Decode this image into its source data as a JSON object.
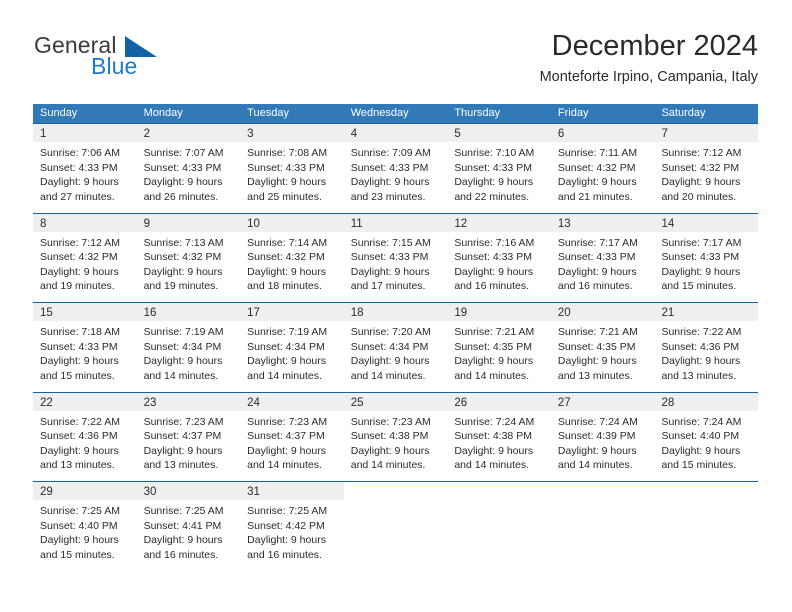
{
  "brand": {
    "name_top": "General",
    "name_bottom": "Blue",
    "triangle_icon": "triangle-icon",
    "accent_color": "#1263a5",
    "blue_text_color": "#1f7ac0"
  },
  "header": {
    "month_title": "December 2024",
    "location": "Monteforte Irpino, Campania, Italy"
  },
  "calendar": {
    "header_bg": "#3279b7",
    "row_divider_color": "#1263a5",
    "daynum_bg": "#efefef",
    "weekdays": [
      "Sunday",
      "Monday",
      "Tuesday",
      "Wednesday",
      "Thursday",
      "Friday",
      "Saturday"
    ],
    "weeks": [
      [
        {
          "day": "1",
          "sunrise": "Sunrise: 7:06 AM",
          "sunset": "Sunset: 4:33 PM",
          "daylight1": "Daylight: 9 hours",
          "daylight2": "and 27 minutes."
        },
        {
          "day": "2",
          "sunrise": "Sunrise: 7:07 AM",
          "sunset": "Sunset: 4:33 PM",
          "daylight1": "Daylight: 9 hours",
          "daylight2": "and 26 minutes."
        },
        {
          "day": "3",
          "sunrise": "Sunrise: 7:08 AM",
          "sunset": "Sunset: 4:33 PM",
          "daylight1": "Daylight: 9 hours",
          "daylight2": "and 25 minutes."
        },
        {
          "day": "4",
          "sunrise": "Sunrise: 7:09 AM",
          "sunset": "Sunset: 4:33 PM",
          "daylight1": "Daylight: 9 hours",
          "daylight2": "and 23 minutes."
        },
        {
          "day": "5",
          "sunrise": "Sunrise: 7:10 AM",
          "sunset": "Sunset: 4:33 PM",
          "daylight1": "Daylight: 9 hours",
          "daylight2": "and 22 minutes."
        },
        {
          "day": "6",
          "sunrise": "Sunrise: 7:11 AM",
          "sunset": "Sunset: 4:32 PM",
          "daylight1": "Daylight: 9 hours",
          "daylight2": "and 21 minutes."
        },
        {
          "day": "7",
          "sunrise": "Sunrise: 7:12 AM",
          "sunset": "Sunset: 4:32 PM",
          "daylight1": "Daylight: 9 hours",
          "daylight2": "and 20 minutes."
        }
      ],
      [
        {
          "day": "8",
          "sunrise": "Sunrise: 7:12 AM",
          "sunset": "Sunset: 4:32 PM",
          "daylight1": "Daylight: 9 hours",
          "daylight2": "and 19 minutes."
        },
        {
          "day": "9",
          "sunrise": "Sunrise: 7:13 AM",
          "sunset": "Sunset: 4:32 PM",
          "daylight1": "Daylight: 9 hours",
          "daylight2": "and 19 minutes."
        },
        {
          "day": "10",
          "sunrise": "Sunrise: 7:14 AM",
          "sunset": "Sunset: 4:32 PM",
          "daylight1": "Daylight: 9 hours",
          "daylight2": "and 18 minutes."
        },
        {
          "day": "11",
          "sunrise": "Sunrise: 7:15 AM",
          "sunset": "Sunset: 4:33 PM",
          "daylight1": "Daylight: 9 hours",
          "daylight2": "and 17 minutes."
        },
        {
          "day": "12",
          "sunrise": "Sunrise: 7:16 AM",
          "sunset": "Sunset: 4:33 PM",
          "daylight1": "Daylight: 9 hours",
          "daylight2": "and 16 minutes."
        },
        {
          "day": "13",
          "sunrise": "Sunrise: 7:17 AM",
          "sunset": "Sunset: 4:33 PM",
          "daylight1": "Daylight: 9 hours",
          "daylight2": "and 16 minutes."
        },
        {
          "day": "14",
          "sunrise": "Sunrise: 7:17 AM",
          "sunset": "Sunset: 4:33 PM",
          "daylight1": "Daylight: 9 hours",
          "daylight2": "and 15 minutes."
        }
      ],
      [
        {
          "day": "15",
          "sunrise": "Sunrise: 7:18 AM",
          "sunset": "Sunset: 4:33 PM",
          "daylight1": "Daylight: 9 hours",
          "daylight2": "and 15 minutes."
        },
        {
          "day": "16",
          "sunrise": "Sunrise: 7:19 AM",
          "sunset": "Sunset: 4:34 PM",
          "daylight1": "Daylight: 9 hours",
          "daylight2": "and 14 minutes."
        },
        {
          "day": "17",
          "sunrise": "Sunrise: 7:19 AM",
          "sunset": "Sunset: 4:34 PM",
          "daylight1": "Daylight: 9 hours",
          "daylight2": "and 14 minutes."
        },
        {
          "day": "18",
          "sunrise": "Sunrise: 7:20 AM",
          "sunset": "Sunset: 4:34 PM",
          "daylight1": "Daylight: 9 hours",
          "daylight2": "and 14 minutes."
        },
        {
          "day": "19",
          "sunrise": "Sunrise: 7:21 AM",
          "sunset": "Sunset: 4:35 PM",
          "daylight1": "Daylight: 9 hours",
          "daylight2": "and 14 minutes."
        },
        {
          "day": "20",
          "sunrise": "Sunrise: 7:21 AM",
          "sunset": "Sunset: 4:35 PM",
          "daylight1": "Daylight: 9 hours",
          "daylight2": "and 13 minutes."
        },
        {
          "day": "21",
          "sunrise": "Sunrise: 7:22 AM",
          "sunset": "Sunset: 4:36 PM",
          "daylight1": "Daylight: 9 hours",
          "daylight2": "and 13 minutes."
        }
      ],
      [
        {
          "day": "22",
          "sunrise": "Sunrise: 7:22 AM",
          "sunset": "Sunset: 4:36 PM",
          "daylight1": "Daylight: 9 hours",
          "daylight2": "and 13 minutes."
        },
        {
          "day": "23",
          "sunrise": "Sunrise: 7:23 AM",
          "sunset": "Sunset: 4:37 PM",
          "daylight1": "Daylight: 9 hours",
          "daylight2": "and 13 minutes."
        },
        {
          "day": "24",
          "sunrise": "Sunrise: 7:23 AM",
          "sunset": "Sunset: 4:37 PM",
          "daylight1": "Daylight: 9 hours",
          "daylight2": "and 14 minutes."
        },
        {
          "day": "25",
          "sunrise": "Sunrise: 7:23 AM",
          "sunset": "Sunset: 4:38 PM",
          "daylight1": "Daylight: 9 hours",
          "daylight2": "and 14 minutes."
        },
        {
          "day": "26",
          "sunrise": "Sunrise: 7:24 AM",
          "sunset": "Sunset: 4:38 PM",
          "daylight1": "Daylight: 9 hours",
          "daylight2": "and 14 minutes."
        },
        {
          "day": "27",
          "sunrise": "Sunrise: 7:24 AM",
          "sunset": "Sunset: 4:39 PM",
          "daylight1": "Daylight: 9 hours",
          "daylight2": "and 14 minutes."
        },
        {
          "day": "28",
          "sunrise": "Sunrise: 7:24 AM",
          "sunset": "Sunset: 4:40 PM",
          "daylight1": "Daylight: 9 hours",
          "daylight2": "and 15 minutes."
        }
      ],
      [
        {
          "day": "29",
          "sunrise": "Sunrise: 7:25 AM",
          "sunset": "Sunset: 4:40 PM",
          "daylight1": "Daylight: 9 hours",
          "daylight2": "and 15 minutes."
        },
        {
          "day": "30",
          "sunrise": "Sunrise: 7:25 AM",
          "sunset": "Sunset: 4:41 PM",
          "daylight1": "Daylight: 9 hours",
          "daylight2": "and 16 minutes."
        },
        {
          "day": "31",
          "sunrise": "Sunrise: 7:25 AM",
          "sunset": "Sunset: 4:42 PM",
          "daylight1": "Daylight: 9 hours",
          "daylight2": "and 16 minutes."
        },
        {
          "day": "",
          "sunrise": "",
          "sunset": "",
          "daylight1": "",
          "daylight2": ""
        },
        {
          "day": "",
          "sunrise": "",
          "sunset": "",
          "daylight1": "",
          "daylight2": ""
        },
        {
          "day": "",
          "sunrise": "",
          "sunset": "",
          "daylight1": "",
          "daylight2": ""
        },
        {
          "day": "",
          "sunrise": "",
          "sunset": "",
          "daylight1": "",
          "daylight2": ""
        }
      ]
    ]
  }
}
